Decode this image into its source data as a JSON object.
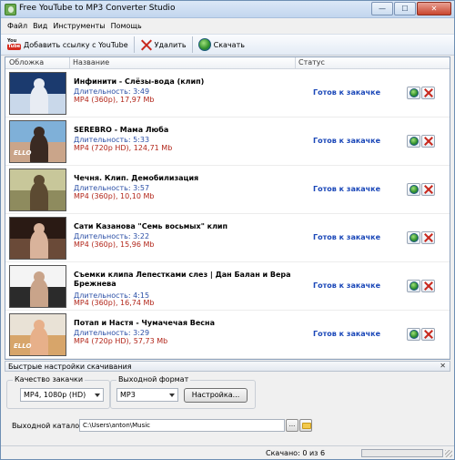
{
  "window": {
    "title": "Free YouTube to MP3 Converter Studio",
    "controls": {
      "minimize": "—",
      "maximize": "☐",
      "close": "✕"
    }
  },
  "menu": [
    "Файл",
    "Вид",
    "Инструменты",
    "Помощь"
  ],
  "toolbar": {
    "add_link": "Добавить ссылку с YouTube",
    "delete": "Удалить",
    "download": "Скачать",
    "yt_small": "You",
    "yt_tube": "Tube"
  },
  "list": {
    "columns": {
      "cover": "Обложка",
      "name": "Название",
      "status": "Статус"
    },
    "rows": [
      {
        "title": "Инфинити - Слёзы-вода (клип)",
        "duration": "Длительность: 3:49",
        "format": "MP4 (360p), 17,97 Mb",
        "status": "Готов к закачке",
        "thumb": {
          "sky": "#1b3a6e",
          "ground": "#c9d8ea",
          "fig": "#e8ecf3",
          "tag": ""
        }
      },
      {
        "title": "SEREBRO - Мама Люба",
        "duration": "Длительность: 5:33",
        "format": "MP4 (720p HD), 124,71 Mb",
        "status": "Готов к закачке",
        "thumb": {
          "sky": "#7fb0d8",
          "ground": "#caa58a",
          "fig": "#3a2a22",
          "tag": "ELLO"
        }
      },
      {
        "title": "Чечня. Клип. Демобилизация",
        "duration": "Длительность: 3:57",
        "format": "MP4 (360p), 10,10 Mb",
        "status": "Готов к закачке",
        "thumb": {
          "sky": "#c8c79a",
          "ground": "#8e8b5e",
          "fig": "#5c4a32",
          "tag": ""
        }
      },
      {
        "title": "Сати Казанова \"Семь восьмых\" клип",
        "duration": "Длительность: 3:22",
        "format": "MP4 (360p), 15,96 Mb",
        "status": "Готов к закачке",
        "thumb": {
          "sky": "#2a1a14",
          "ground": "#6a4a38",
          "fig": "#d9b39b",
          "tag": ""
        }
      },
      {
        "title": "Съемки клипа Лепестками слез | Дан Балан и Вера Брежнева",
        "duration": "Длительность: 4:15",
        "format": "MP4 (360p), 16,74 Mb",
        "status": "Готов к закачке",
        "thumb": {
          "sky": "#f4f4f4",
          "ground": "#2b2b2b",
          "fig": "#c9a48a",
          "tag": ""
        }
      },
      {
        "title": "Потап и Настя - Чумачечая Весна",
        "duration": "Длительность: 3:29",
        "format": "MP4 (720p HD), 57,73 Mb",
        "status": "Готов к закачке",
        "thumb": {
          "sky": "#e9e2d6",
          "ground": "#d7a56a",
          "fig": "#e7b08a",
          "tag": "ELLO"
        }
      }
    ]
  },
  "settings": {
    "title": "Быстрые настройки скачивания",
    "close": "✕",
    "quality_label": "Качество закачки",
    "quality_value": "MP4, 1080p (HD)",
    "format_label": "Выходной формат",
    "format_value": "MP3",
    "setup_button": "Настройка...",
    "output_label": "Выходной каталог",
    "output_path": "C:\\Users\\anton\\Music",
    "browse": "..."
  },
  "statusbar": {
    "text": "Скачано: 0 из 6",
    "progress": 0
  }
}
